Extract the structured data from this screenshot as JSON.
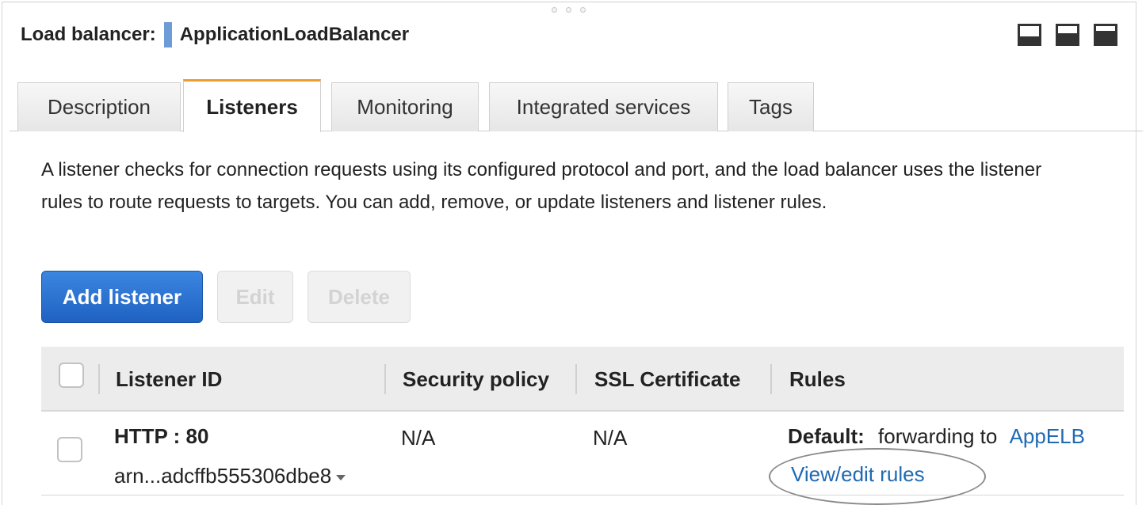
{
  "header": {
    "label": "Load balancer:",
    "name": "ApplicationLoadBalancer"
  },
  "window_controls": [
    "panel-bottom-icon",
    "panel-split-icon",
    "panel-top-icon"
  ],
  "tabs": [
    {
      "label": "Description"
    },
    {
      "label": "Listeners",
      "active": true
    },
    {
      "label": "Monitoring"
    },
    {
      "label": "Integrated services"
    },
    {
      "label": "Tags"
    }
  ],
  "description": "A listener checks for connection requests using its configured protocol and port, and the load balancer uses the listener rules to route requests to targets. You can add, remove, or update listeners and listener rules.",
  "actions": {
    "add": "Add listener",
    "edit": "Edit",
    "delete": "Delete"
  },
  "table": {
    "columns": [
      "Listener ID",
      "Security policy",
      "SSL Certificate",
      "Rules"
    ],
    "rows": [
      {
        "listener": "HTTP : 80",
        "arn": "arn...adcffb555306dbe8",
        "security_policy": "N/A",
        "ssl_certificate": "N/A",
        "rules_default_label": "Default:",
        "rules_default_text": "forwarding to",
        "rules_target": "AppELB",
        "rules_link": "View/edit rules"
      }
    ]
  },
  "colors": {
    "accent_tab": "#ec9d2f",
    "primary_button": "#1f62c2",
    "link": "#1f6ab3",
    "name_marker": "#6c9bd6"
  }
}
